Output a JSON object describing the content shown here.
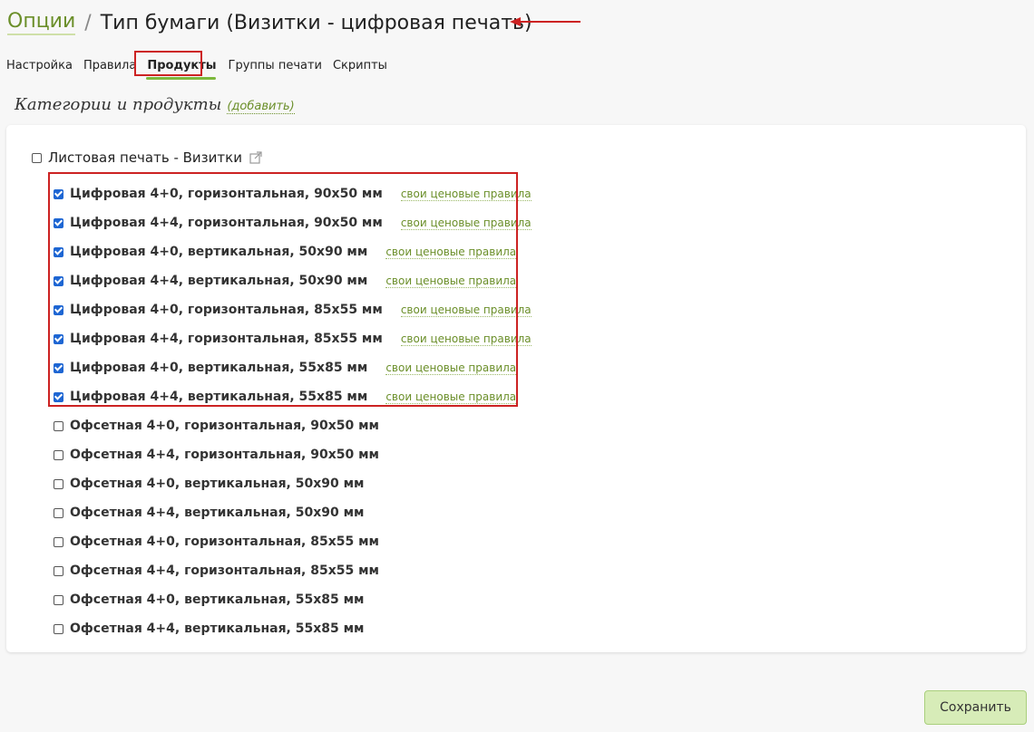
{
  "header": {
    "breadcrumb_link": "Опции",
    "separator": "/",
    "title": "Тип бумаги (Визитки - цифровая печать)"
  },
  "tabs": [
    {
      "label": "Настройка",
      "active": false
    },
    {
      "label": "Правила",
      "active": false
    },
    {
      "label": "Продукты",
      "active": true
    },
    {
      "label": "Группы печати",
      "active": false
    },
    {
      "label": "Скрипты",
      "active": false
    }
  ],
  "section": {
    "title": "Категории и продукты",
    "add_label": "(добавить)"
  },
  "category": {
    "label": "Листовая печать - Визитки",
    "checked": false
  },
  "rule_link_label": "свои ценовые правила",
  "products": [
    {
      "label": "Цифровая 4+0, горизонтальная, 90x50 мм",
      "checked": true,
      "rules": "свои ценовые правила"
    },
    {
      "label": "Цифровая 4+4, горизонтальная, 90x50 мм",
      "checked": true,
      "rules": "свои ценовые правила"
    },
    {
      "label": "Цифровая 4+0, вертикальная, 50x90 мм",
      "checked": true,
      "rules": "свои ценовые правила"
    },
    {
      "label": "Цифровая 4+4, вертикальная, 50x90 мм",
      "checked": true,
      "rules": "свои ценовые правила"
    },
    {
      "label": "Цифровая 4+0, горизонтальная, 85x55 мм",
      "checked": true,
      "rules": "свои ценовые правила"
    },
    {
      "label": "Цифровая 4+4, горизонтальная, 85x55 мм",
      "checked": true,
      "rules": "свои ценовые правила"
    },
    {
      "label": "Цифровая 4+0, вертикальная, 55x85 мм",
      "checked": true,
      "rules": "свои ценовые правила"
    },
    {
      "label": "Цифровая 4+4, вертикальная, 55x85 мм",
      "checked": true,
      "rules": "свои ценовые правила"
    },
    {
      "label": "Офсетная 4+0, горизонтальная, 90x50 мм",
      "checked": false
    },
    {
      "label": "Офсетная 4+4, горизонтальная, 90x50 мм",
      "checked": false
    },
    {
      "label": "Офсетная 4+0, вертикальная, 50x90 мм",
      "checked": false
    },
    {
      "label": "Офсетная 4+4, вертикальная, 50x90 мм",
      "checked": false
    },
    {
      "label": "Офсетная 4+0, горизонтальная, 85x55 мм",
      "checked": false
    },
    {
      "label": "Офсетная 4+4, горизонтальная, 85x55 мм",
      "checked": false
    },
    {
      "label": "Офсетная 4+0, вертикальная, 55x85 мм",
      "checked": false
    },
    {
      "label": "Офсетная 4+4, вертикальная, 55x85 мм",
      "checked": false
    }
  ],
  "footer": {
    "save_label": "Сохранить"
  },
  "colors": {
    "accent_green": "#6b8f2a",
    "tab_underline": "#7cb83c",
    "highlight_red": "#cc2222",
    "checkbox_blue": "#1e66d3",
    "save_bg": "#d7ecb8"
  }
}
